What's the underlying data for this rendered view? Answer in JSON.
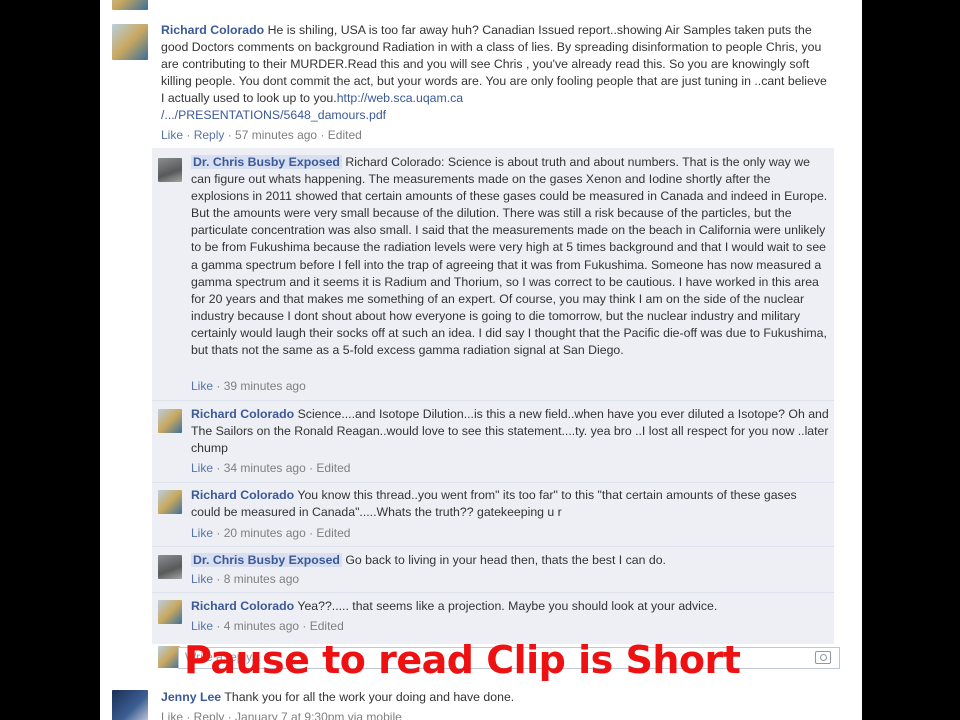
{
  "comments": [
    {
      "author": "Richard Colorado",
      "text": "He is shiling, USA is too far away huh? Canadian Issued report..showing Air Samples taken puts the good Doctors comments on background Radiation in with a class of lies. By spreading disinformation to people Chris, you are contributing to their MURDER.Read this and you will see Chris , you've already read this. So you are knowingly soft killing people. You dont commit the act, but your words are. You are only fooling people that are just tuning in ..cant believe I actually used to look up to you.",
      "link": "http://web.sca.uqam.ca/.../PRESENTATIONS/5648_damours.pdf",
      "link_line1": "http://web.sca.uqam.ca",
      "link_line2": "/.../PRESENTATIONS/5648_damours.pdf",
      "like": "Like",
      "reply": "Reply",
      "time": "57 minutes ago",
      "edited": "Edited"
    }
  ],
  "replies": [
    {
      "author": "Dr. Chris Busby Exposed",
      "text": "Richard Colorado: Science is about truth and about numbers. That is the only way we can figure out whats happening. The measurements made on the gases Xenon and Iodine shortly after the explosions in 2011 showed that certain amounts of these gases could be measured in Canada and indeed in Europe. But the amounts were very small because of the dilution. There was still a risk because of the particles, but the particulate concentration was also small. I said that the measurements made on the beach in California were unlikely to be from Fukushima because the radiation levels were very high at 5 times background and that I would wait to see a gamma spectrum before I fell into the trap of agreeing that it was from Fukushima. Someone has now measured a gamma spectrum and it seems it is Radium and Thorium, so I was correct to be cautious. I have worked in this area for 20 years and that makes me something of an expert. Of course, you may think I am on the side of the nuclear industry because I dont shout about how everyone is going to die tomorrow, but the nuclear industry and military certainly would laugh their socks off at such an idea. I did say I thought that the Pacific die-off was due to Fukushima, but thats not the same as a 5-fold excess gamma radiation signal at San Diego.",
      "like": "Like",
      "time": "39 minutes ago",
      "edited": ""
    },
    {
      "author": "Richard Colorado",
      "text": "Science....and Isotope Dilution...is this a new field..when have you ever diluted a Isotope? Oh and The Sailors on the Ronald Reagan..would love to see this statement....ty. yea bro ..I lost all respect for you now ..later chump",
      "like": "Like",
      "time": "34 minutes ago",
      "edited": "Edited"
    },
    {
      "author": "Richard Colorado",
      "text": "You know this thread..you went from\" its too far\" to this \"that certain amounts of these gases could be measured in Canada\".....Whats the truth?? gatekeeping u r",
      "like": "Like",
      "time": "20 minutes ago",
      "edited": "Edited"
    },
    {
      "author": "Dr. Chris Busby Exposed",
      "text": "Go back to living in your head then, thats the best I can do.",
      "like": "Like",
      "time": "8 minutes ago",
      "edited": ""
    },
    {
      "author": "Richard Colorado",
      "text": "Yea??..... that seems like a projection. Maybe you should look at your advice.",
      "like": "Like",
      "time": "4 minutes ago",
      "edited": "Edited"
    }
  ],
  "write_reply": {
    "placeholder": "Write a reply..."
  },
  "next_comment": {
    "author": "Jenny Lee",
    "text": "Thank you for all the work your doing and have done.",
    "meta": "Like · Reply · January 7 at 9:30pm via mobile"
  },
  "overlay_caption": "Pause to read Clip is Short",
  "colors": {
    "link": "#3b5998",
    "reply_background": "#edeff4",
    "caption": "#ee1111",
    "letterbox": "#000000"
  }
}
